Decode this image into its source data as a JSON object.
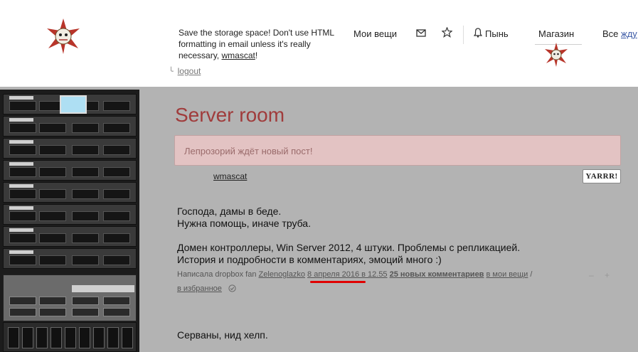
{
  "header": {
    "notice_text": "Save the storage space! Don't use HTML formatting in email unless it's really necessary,",
    "notice_user": "wmascat",
    "notice_end": "!",
    "logout_label": "logout"
  },
  "nav": {
    "my_things": "Мои вещи",
    "pyn": "Пынь",
    "shop": "Магазин",
    "all_prefix": "Все ",
    "all_link": "жду"
  },
  "post": {
    "title": "Server room",
    "alert": "Лепрозорий ждёт новый пост!",
    "author": "wmascat",
    "yarrr": "YARRR!",
    "lines": [
      "Господа, дамы в беде.",
      "Нужна помощь, иначе труба.",
      "Домен контроллеры, Win Server 2012, 4 штуки. Проблемы с репликацией.",
      "История и подробности в комментариях, эмоций много :)"
    ],
    "meta": {
      "written_by": "Написала dropbox fan",
      "user": "Zelenoglazko",
      "date": "8 апреля 2016 в 12.55",
      "comments": "25 новых комментариев",
      "to_my_things": "в мои вещи",
      "separator": "/",
      "to_favorites": "в избранное"
    },
    "vote_minus": "–",
    "vote_plus": "+",
    "next_post": "Серваны, нид хелп."
  },
  "colors": {
    "title": "#a03c3c",
    "alert_bg": "#e3c3c3",
    "content_bg": "#b3b3b3",
    "highlight": "#e00000"
  }
}
